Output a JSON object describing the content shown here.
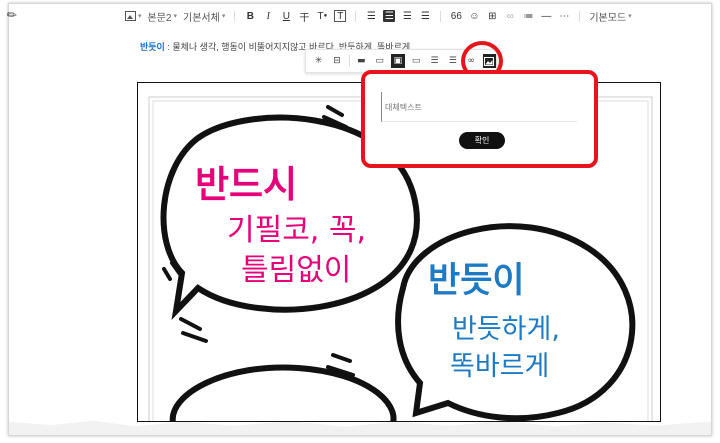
{
  "toolbar": {
    "paragraph_style": "본문2",
    "font_family": "기본서체",
    "bold": "B",
    "italic": "I",
    "underline": "U",
    "strike": "干",
    "text_color": "T",
    "text_bg": "T",
    "quote": "66",
    "more": "⋯",
    "mode": "기본모드"
  },
  "definition": {
    "term": "반듯이",
    "text": " : 물체나 생각, 행동이 비뚤어지지않고 바르다. 반듯하게, 똑바르게"
  },
  "image": {
    "bubble1_title": "반드시",
    "bubble1_line1": "기필코, 꼭,",
    "bubble1_line2": "틀림없이",
    "bubble2_title": "반듯이",
    "bubble2_line1": "반듯하게,",
    "bubble2_line2": "똑바르게"
  },
  "alt_popup": {
    "placeholder": "대체텍스트",
    "confirm_label": "확인"
  },
  "colors": {
    "highlight_red": "#e8141b",
    "pink": "#e6007a",
    "blue": "#1f7ac4",
    "term_blue": "#1a6cc8"
  }
}
